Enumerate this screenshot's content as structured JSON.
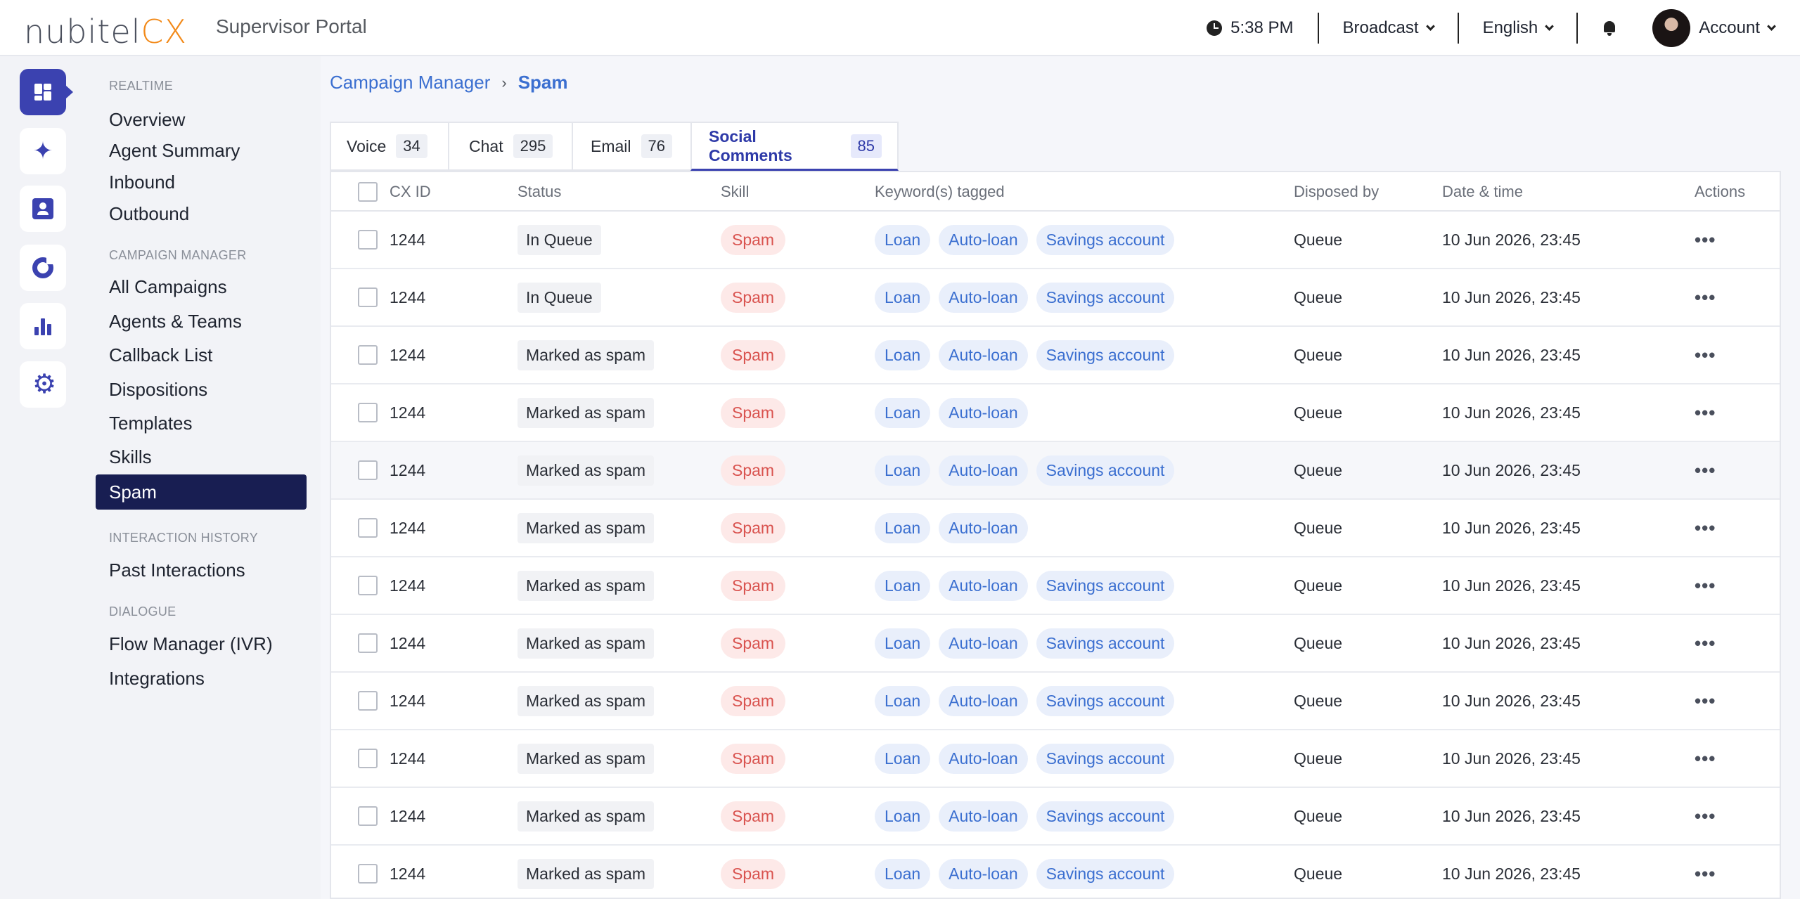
{
  "app": {
    "logo_main": "nubitel",
    "logo_suffix": "CX",
    "title": "Supervisor Portal"
  },
  "topbar": {
    "time": "5:38 PM",
    "broadcast": "Broadcast",
    "language": "English",
    "account": "Account"
  },
  "rail": {
    "icons": [
      "dashboard-icon",
      "sparkle-icon",
      "contact-card-icon",
      "ring-chart-icon",
      "bar-chart-icon",
      "gear-icon"
    ]
  },
  "nav": {
    "sections": [
      {
        "label": "REALTIME",
        "items": [
          "Overview",
          "Agent Summary",
          "Inbound",
          "Outbound"
        ]
      },
      {
        "label": "CAMPAIGN MANAGER",
        "items": [
          "All Campaigns",
          "Agents & Teams",
          "Callback List",
          "Dispositions",
          "Templates",
          "Skills",
          "Spam"
        ]
      },
      {
        "label": "INTERACTION HISTORY",
        "items": [
          "Past Interactions"
        ]
      },
      {
        "label": "DIALOGUE",
        "items": [
          "Flow Manager (IVR)",
          "Integrations"
        ]
      }
    ],
    "active": "Spam"
  },
  "breadcrumb": {
    "parent": "Campaign Manager",
    "separator": "›",
    "current": "Spam"
  },
  "tabs": [
    {
      "label": "Voice",
      "count": "34"
    },
    {
      "label": "Chat",
      "count": "295"
    },
    {
      "label": "Email",
      "count": "76"
    },
    {
      "label": "Social Comments",
      "count": "85",
      "active": true
    }
  ],
  "table": {
    "columns": [
      "CX ID",
      "Status",
      "Skill",
      "Keyword(s) tagged",
      "Disposed by",
      "Date & time",
      "Actions"
    ],
    "rows": [
      {
        "id": "1244",
        "status": "In Queue",
        "skill": "Spam",
        "keywords": [
          "Loan",
          "Auto-loan",
          "Savings account"
        ],
        "disposed_by": "Queue",
        "datetime": "10 Jun 2026, 23:45"
      },
      {
        "id": "1244",
        "status": "In Queue",
        "skill": "Spam",
        "keywords": [
          "Loan",
          "Auto-loan",
          "Savings account"
        ],
        "disposed_by": "Queue",
        "datetime": "10 Jun 2026, 23:45"
      },
      {
        "id": "1244",
        "status": "Marked as spam",
        "skill": "Spam",
        "keywords": [
          "Loan",
          "Auto-loan",
          "Savings account"
        ],
        "disposed_by": "Queue",
        "datetime": "10 Jun 2026, 23:45"
      },
      {
        "id": "1244",
        "status": "Marked as spam",
        "skill": "Spam",
        "keywords": [
          "Loan",
          "Auto-loan"
        ],
        "disposed_by": "Queue",
        "datetime": "10 Jun 2026, 23:45"
      },
      {
        "id": "1244",
        "status": "Marked as spam",
        "skill": "Spam",
        "keywords": [
          "Loan",
          "Auto-loan",
          "Savings account"
        ],
        "disposed_by": "Queue",
        "datetime": "10 Jun 2026, 23:45",
        "highlighted": true
      },
      {
        "id": "1244",
        "status": "Marked as spam",
        "skill": "Spam",
        "keywords": [
          "Loan",
          "Auto-loan"
        ],
        "disposed_by": "Queue",
        "datetime": "10 Jun 2026, 23:45"
      },
      {
        "id": "1244",
        "status": "Marked as spam",
        "skill": "Spam",
        "keywords": [
          "Loan",
          "Auto-loan",
          "Savings account"
        ],
        "disposed_by": "Queue",
        "datetime": "10 Jun 2026, 23:45"
      },
      {
        "id": "1244",
        "status": "Marked as spam",
        "skill": "Spam",
        "keywords": [
          "Loan",
          "Auto-loan",
          "Savings account"
        ],
        "disposed_by": "Queue",
        "datetime": "10 Jun 2026, 23:45"
      },
      {
        "id": "1244",
        "status": "Marked as spam",
        "skill": "Spam",
        "keywords": [
          "Loan",
          "Auto-loan",
          "Savings account"
        ],
        "disposed_by": "Queue",
        "datetime": "10 Jun 2026, 23:45"
      },
      {
        "id": "1244",
        "status": "Marked as spam",
        "skill": "Spam",
        "keywords": [
          "Loan",
          "Auto-loan",
          "Savings account"
        ],
        "disposed_by": "Queue",
        "datetime": "10 Jun 2026, 23:45"
      },
      {
        "id": "1244",
        "status": "Marked as spam",
        "skill": "Spam",
        "keywords": [
          "Loan",
          "Auto-loan",
          "Savings account"
        ],
        "disposed_by": "Queue",
        "datetime": "10 Jun 2026, 23:45"
      },
      {
        "id": "1244",
        "status": "Marked as spam",
        "skill": "Spam",
        "keywords": [
          "Loan",
          "Auto-loan",
          "Savings account"
        ],
        "disposed_by": "Queue",
        "datetime": "10 Jun 2026, 23:45"
      }
    ],
    "actions_glyph": "•••"
  },
  "colors": {
    "accent": "#3b42b0",
    "nav_active_bg": "#181e52",
    "link": "#3b6fd0",
    "brand_orange": "#f28a1a",
    "spam_tag": "#d9534f"
  }
}
